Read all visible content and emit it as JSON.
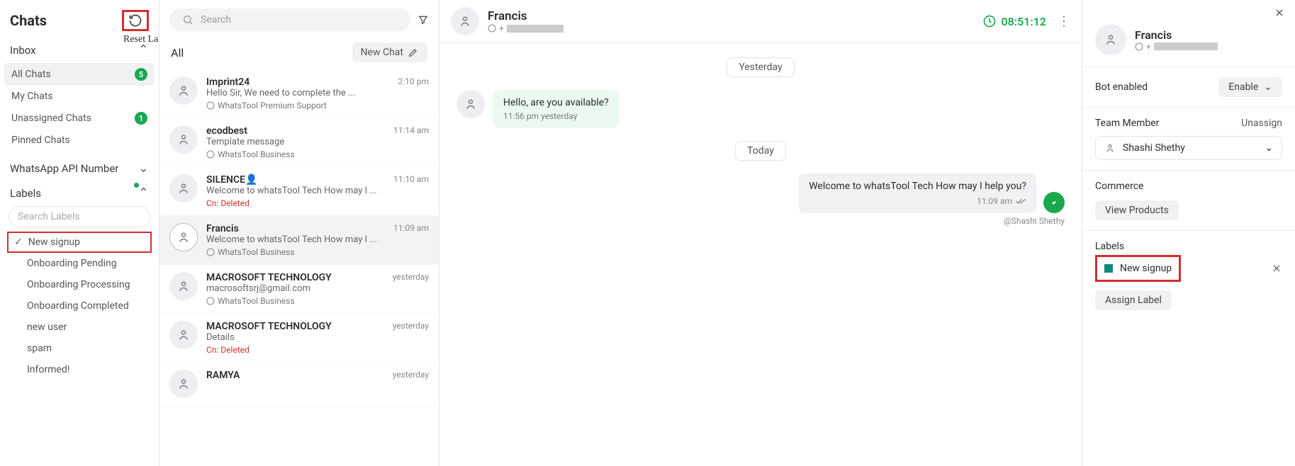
{
  "header": {
    "title": "Chats",
    "reset_tooltip": "Reset Label Filter"
  },
  "search": {
    "placeholder": "Search"
  },
  "sidebar": {
    "inbox_label": "Inbox",
    "items": [
      {
        "label": "All Chats",
        "badge": "5"
      },
      {
        "label": "My Chats"
      },
      {
        "label": "Unassigned Chats",
        "badge": "1"
      },
      {
        "label": "Pinned Chats"
      }
    ],
    "api_label": "WhatsApp API Number",
    "labels_label": "Labels",
    "labels_search_placeholder": "Search Labels",
    "labels": [
      "New signup",
      "Onboarding Pending",
      "Onboarding Processing",
      "Onboarding Completed",
      "new user",
      "spam",
      "Informed!"
    ]
  },
  "list": {
    "all": "All",
    "new_chat": "New Chat",
    "items": [
      {
        "name": "Imprint24",
        "preview": "Hello Sir, We need to complete the ...",
        "time": "2:10 pm",
        "tag": "WhatsTool Premium Support",
        "tag_icon": "wa"
      },
      {
        "name": "ecodbest",
        "preview": "Template message",
        "time": "11:14 am",
        "tag": "WhatsTool Business",
        "tag_icon": "wa"
      },
      {
        "name": "SILENCE",
        "name_emoji": "👤",
        "preview": "Welcome to whatsTool Tech How may I ...",
        "time": "11:10 am",
        "tag": "Cn: Deleted",
        "tag_red": true
      },
      {
        "name": "Francis",
        "preview": "Welcome to whatsTool Tech How may I ...",
        "time": "11:09 am",
        "tag": "WhatsTool Business",
        "tag_icon": "wa",
        "active": true
      },
      {
        "name": "MACROSOFT TECHNOLOGY",
        "preview": "macrosoftsrj@gmail.com",
        "time": "yesterday",
        "tag": "WhatsTool Business",
        "tag_icon": "wa"
      },
      {
        "name": "MACROSOFT TECHNOLOGY",
        "preview": "Details",
        "time": "yesterday",
        "tag": "Cn: Deleted",
        "tag_red": true
      },
      {
        "name": "RAMYA",
        "preview": "",
        "time": "yesterday"
      }
    ]
  },
  "conv": {
    "name": "Francis",
    "phone_prefix": "+",
    "timer": "08:51:12",
    "day1": "Yesterday",
    "day2": "Today",
    "msg_in_text": "Hello, are you available?",
    "msg_in_ts": "11:56 pm yesterday",
    "msg_out_text": "Welcome to whatsTool Tech How may I help you?",
    "msg_out_ts": "11:09 am",
    "sender": "@Shashi Shethy"
  },
  "details": {
    "name": "Francis",
    "phone_prefix": "+",
    "bot_label": "Bot enabled",
    "bot_action": "Enable",
    "team_label": "Team Member",
    "unassign": "Unassign",
    "member": "Shashi Shethy",
    "commerce_label": "Commerce",
    "view_products": "View Products",
    "labels_label": "Labels",
    "label_name": "New signup",
    "assign_label": "Assign Label"
  }
}
